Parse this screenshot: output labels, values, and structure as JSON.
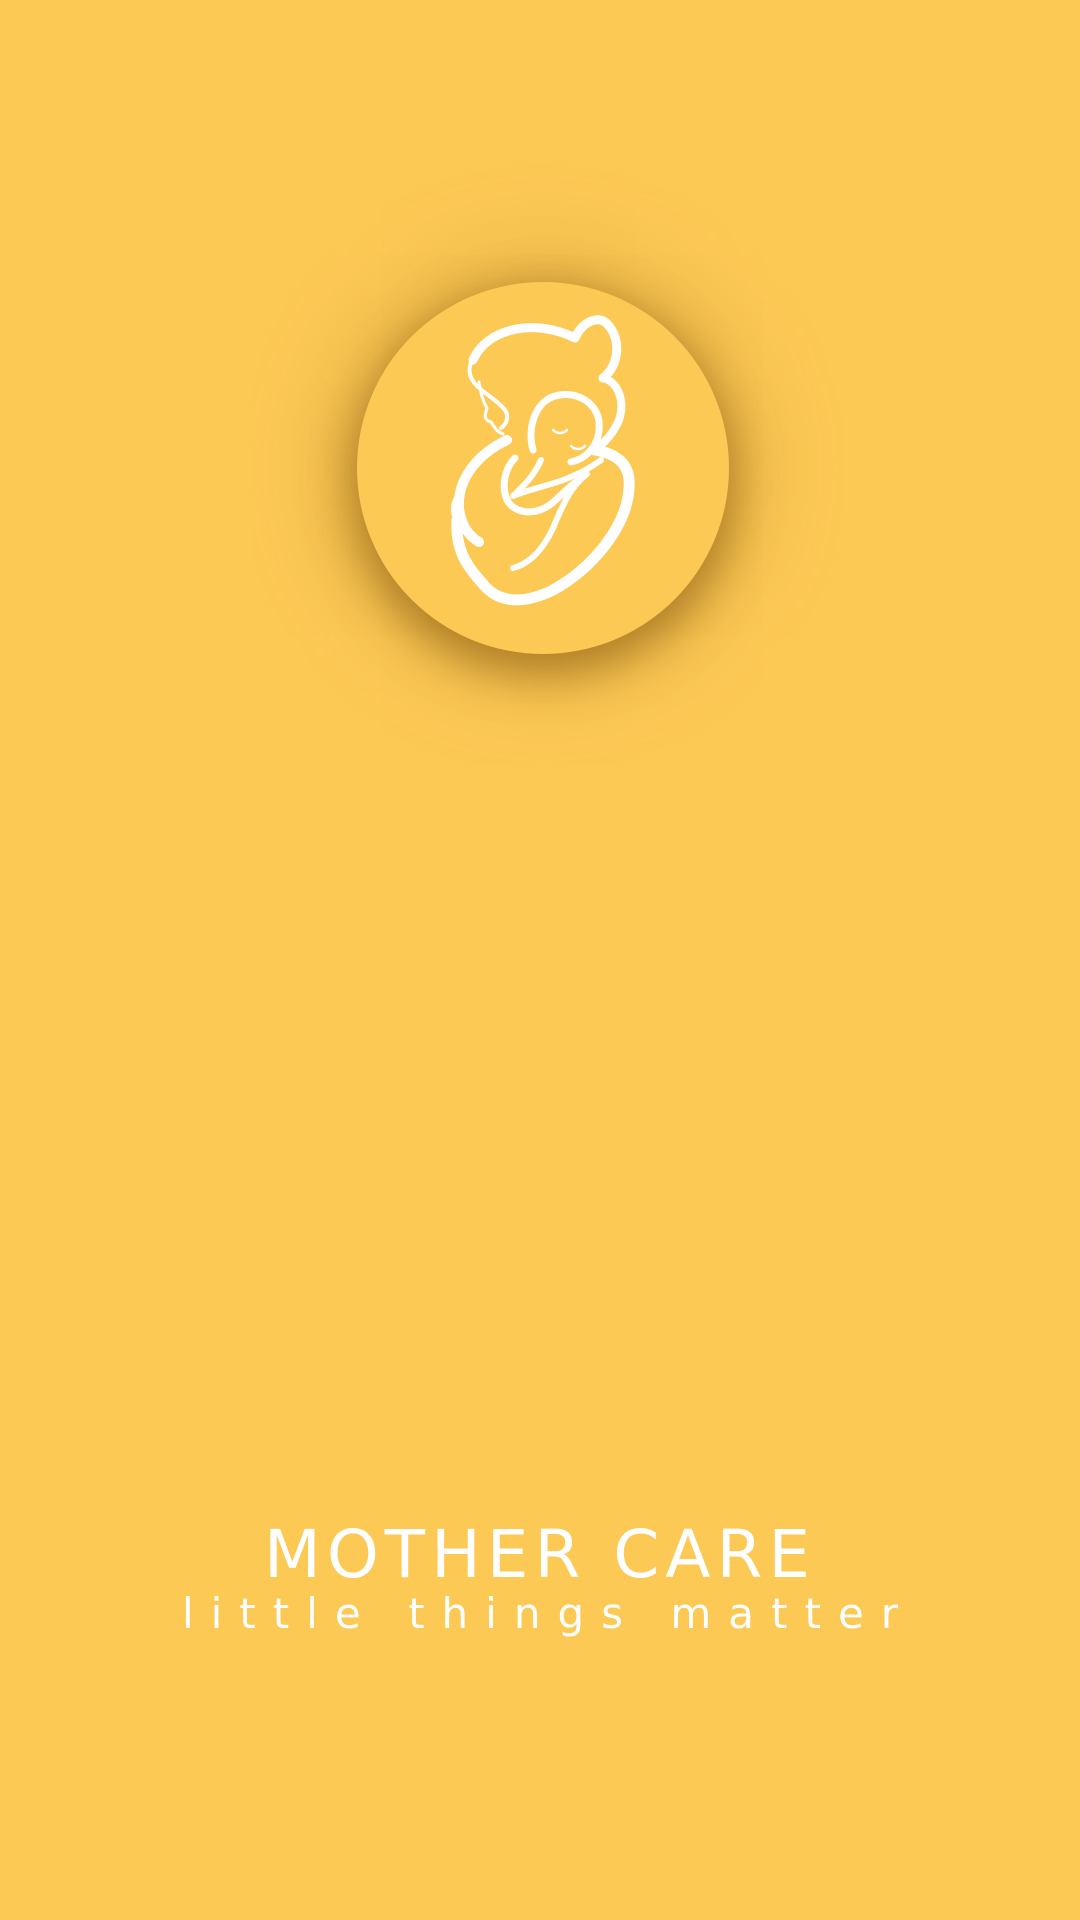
{
  "theme": {
    "background": "#FDC955",
    "foreground": "#FFFFFF"
  },
  "logo": {
    "icon": "mother-and-baby-icon"
  },
  "brand": {
    "title": "MOTHER CARE",
    "tagline": "little things matter"
  }
}
